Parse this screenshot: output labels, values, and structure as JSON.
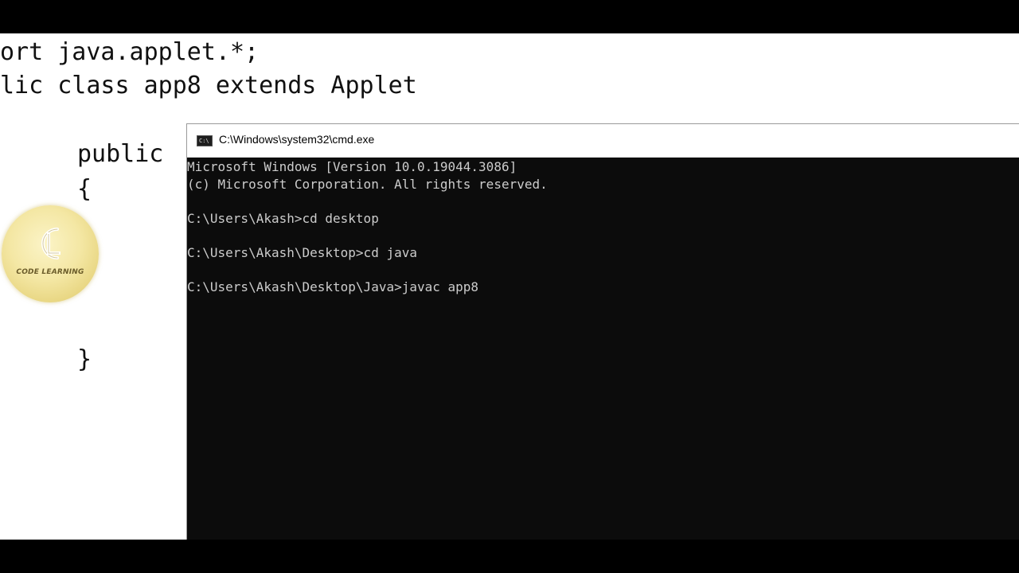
{
  "editor": {
    "lines": [
      "ort java.applet.*;",
      "lic class app8 extends Applet",
      "public",
      "{",
      "}"
    ]
  },
  "logo": {
    "text": "CODE LEARNING",
    "color": "#f4e7a4"
  },
  "cmd": {
    "title": "C:\\Windows\\system32\\cmd.exe",
    "icon": "cmd-app-icon",
    "icon_glyph": "C:\\",
    "lines": [
      "Microsoft Windows [Version 10.0.19044.3086]",
      "(c) Microsoft Corporation. All rights reserved.",
      "",
      "C:\\Users\\Akash>cd desktop",
      "",
      "C:\\Users\\Akash\\Desktop>cd java",
      "",
      "C:\\Users\\Akash\\Desktop\\Java>javac app8"
    ],
    "background": "#0c0c0c",
    "text_color": "#cccccc"
  }
}
